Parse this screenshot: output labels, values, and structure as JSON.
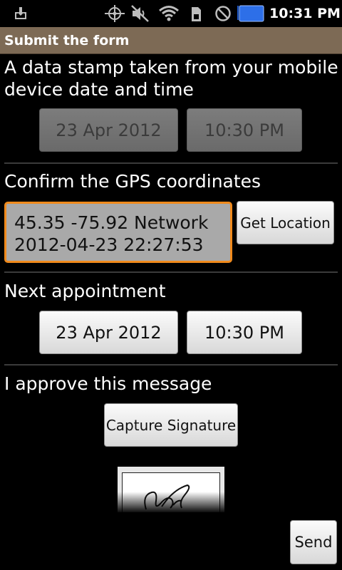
{
  "status_bar": {
    "time": "10:31 PM",
    "icons": [
      "download-icon",
      "gps-icon",
      "mute-icon",
      "wifi-icon",
      "signal-icon",
      "no-sim-icon",
      "battery-icon"
    ],
    "battery_color": "#2d6fe8"
  },
  "title_bar": {
    "title": "Submit the form",
    "color": "#7d6a55"
  },
  "stamp_section": {
    "label": "A data stamp taken from your mobile device date and time",
    "line1": "A data stamp taken from your mobile",
    "line2": "device date and time",
    "date": "23 Apr 2012",
    "time": "10:30 PM"
  },
  "gps_section": {
    "label": "Confirm the GPS coordinates",
    "coordinates": "45.35 -75.92 Network",
    "timestamp": "2012-04-23 22:27:53",
    "button_label": "Get Location",
    "focus_color": "#f08a1c"
  },
  "appointment_section": {
    "label": "Next appointment",
    "date": "23 Apr 2012",
    "time": "10:30 PM"
  },
  "approve_section": {
    "label": "I approve this message",
    "button_label": "Capture Signature"
  },
  "send_button": {
    "label": "Send"
  }
}
